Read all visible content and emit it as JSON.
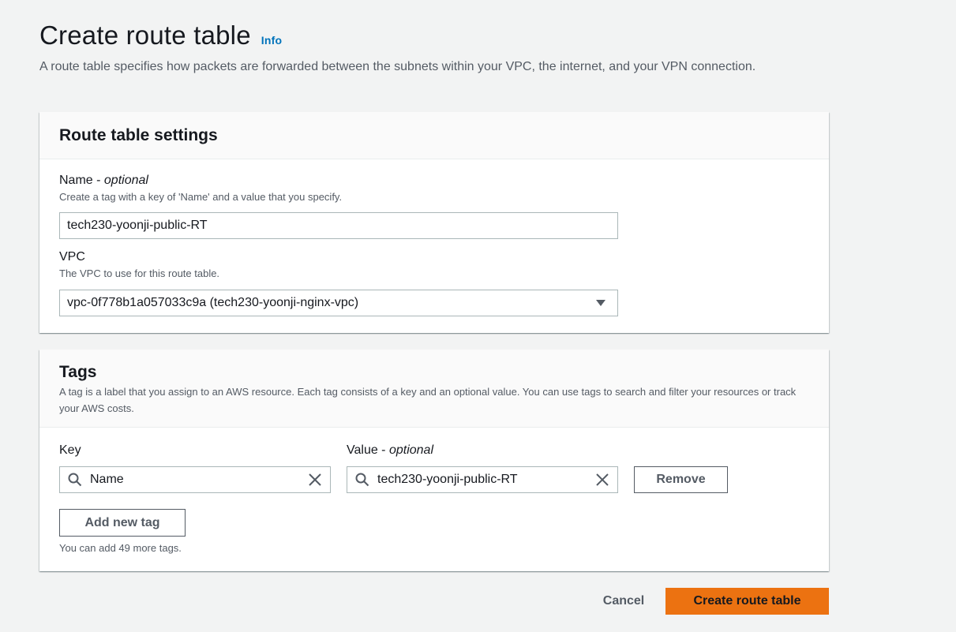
{
  "page": {
    "title": "Create route table",
    "info_link": "Info",
    "description": "A route table specifies how packets are forwarded between the subnets within your VPC, the internet, and your VPN connection."
  },
  "settings": {
    "title": "Route table settings",
    "name_label": "Name",
    "name_optional": "optional",
    "name_desc": "Create a tag with a key of 'Name' and a value that you specify.",
    "name_value": "tech230-yoonji-public-RT",
    "vpc_label": "VPC",
    "vpc_desc": "The VPC to use for this route table.",
    "vpc_value": "vpc-0f778b1a057033c9a (tech230-yoonji-nginx-vpc)"
  },
  "tags": {
    "title": "Tags",
    "description": "A tag is a label that you assign to an AWS resource. Each tag consists of a key and an optional value. You can use tags to search and filter your resources or track your AWS costs.",
    "key_label": "Key",
    "value_label": "Value",
    "value_optional": "optional",
    "rows": [
      {
        "key": "Name",
        "value": "tech230-yoonji-public-RT",
        "remove_label": "Remove"
      }
    ],
    "add_label": "Add new tag",
    "limit_text": "You can add 49 more tags."
  },
  "footer": {
    "cancel_label": "Cancel",
    "submit_label": "Create route table"
  },
  "colors": {
    "primary_button": "#ec7211",
    "link": "#0073bb",
    "background": "#f2f3f3"
  },
  "icons": [
    "search-icon",
    "clear-icon",
    "caret-down-icon"
  ]
}
